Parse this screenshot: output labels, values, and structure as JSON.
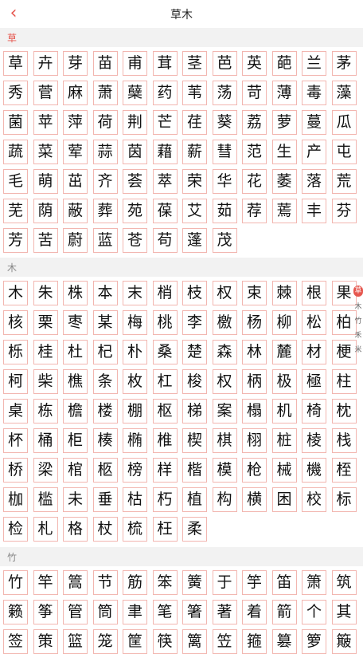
{
  "header": {
    "title": "草木",
    "back_icon": "chevron-left-icon"
  },
  "accent_color": "#e6574f",
  "sections": [
    {
      "label": "草",
      "label_color": "#e6574f",
      "chars": [
        "草",
        "卉",
        "芽",
        "苗",
        "甫",
        "茸",
        "茎",
        "芭",
        "英",
        "葩",
        "兰",
        "茅",
        "秀",
        "菅",
        "麻",
        "萧",
        "蘖",
        "药",
        "苇",
        "荡",
        "苛",
        "薄",
        "毒",
        "藻",
        "菌",
        "苹",
        "萍",
        "荷",
        "荆",
        "芒",
        "荏",
        "葵",
        "荔",
        "萝",
        "蔓",
        "瓜",
        "蔬",
        "菜",
        "荤",
        "蒜",
        "茵",
        "藉",
        "薪",
        "彗",
        "范",
        "生",
        "产",
        "屯",
        "毛",
        "萌",
        "茁",
        "齐",
        "荟",
        "萃",
        "荣",
        "华",
        "花",
        "萎",
        "落",
        "荒",
        "芜",
        "荫",
        "蔽",
        "葬",
        "苑",
        "葆",
        "艾",
        "茹",
        "荐",
        "蔫",
        "丰",
        "芬",
        "芳",
        "苦",
        "蔚",
        "蓝",
        "苍",
        "苟",
        "蓬",
        "茂"
      ]
    },
    {
      "label": "木",
      "label_color": "#888888",
      "chars": [
        "木",
        "朱",
        "株",
        "本",
        "末",
        "梢",
        "枝",
        "权",
        "束",
        "棘",
        "根",
        "果",
        "核",
        "栗",
        "枣",
        "某",
        "梅",
        "桃",
        "李",
        "檄",
        "杨",
        "柳",
        "松",
        "柏",
        "栎",
        "桂",
        "杜",
        "杞",
        "朴",
        "桑",
        "楚",
        "森",
        "林",
        "麓",
        "材",
        "梗",
        "柯",
        "柴",
        "樵",
        "条",
        "枚",
        "杠",
        "梭",
        "权",
        "柄",
        "极",
        "極",
        "柱",
        "桌",
        "栋",
        "檐",
        "楼",
        "棚",
        "枢",
        "梯",
        "案",
        "榻",
        "机",
        "椅",
        "枕",
        "杯",
        "桶",
        "柜",
        "楱",
        "椭",
        "椎",
        "楔",
        "棋",
        "栩",
        "桩",
        "棱",
        "栈",
        "桥",
        "梁",
        "棺",
        "柩",
        "榜",
        "样",
        "楷",
        "模",
        "枪",
        "械",
        "機",
        "桎",
        "枷",
        "槛",
        "未",
        "垂",
        "枯",
        "朽",
        "植",
        "构",
        "横",
        "困",
        "校",
        "标",
        "检",
        "札",
        "格",
        "杖",
        "梳",
        "枉",
        "柔"
      ]
    },
    {
      "label": "竹",
      "label_color": "#888888",
      "chars": [
        "竹",
        "竿",
        "篙",
        "节",
        "筋",
        "笨",
        "簧",
        "于",
        "竽",
        "笛",
        "箫",
        "筑",
        "籁",
        "筝",
        "管",
        "筒",
        "聿",
        "笔",
        "箸",
        "著",
        "着",
        "箭",
        "个",
        "其",
        "签",
        "策",
        "篮",
        "笼",
        "筐",
        "筷",
        "篱",
        "笠",
        "箍",
        "篡",
        "箩",
        "簸"
      ]
    }
  ],
  "side_index": [
    "草",
    "木",
    "竹",
    "禾",
    "米"
  ]
}
